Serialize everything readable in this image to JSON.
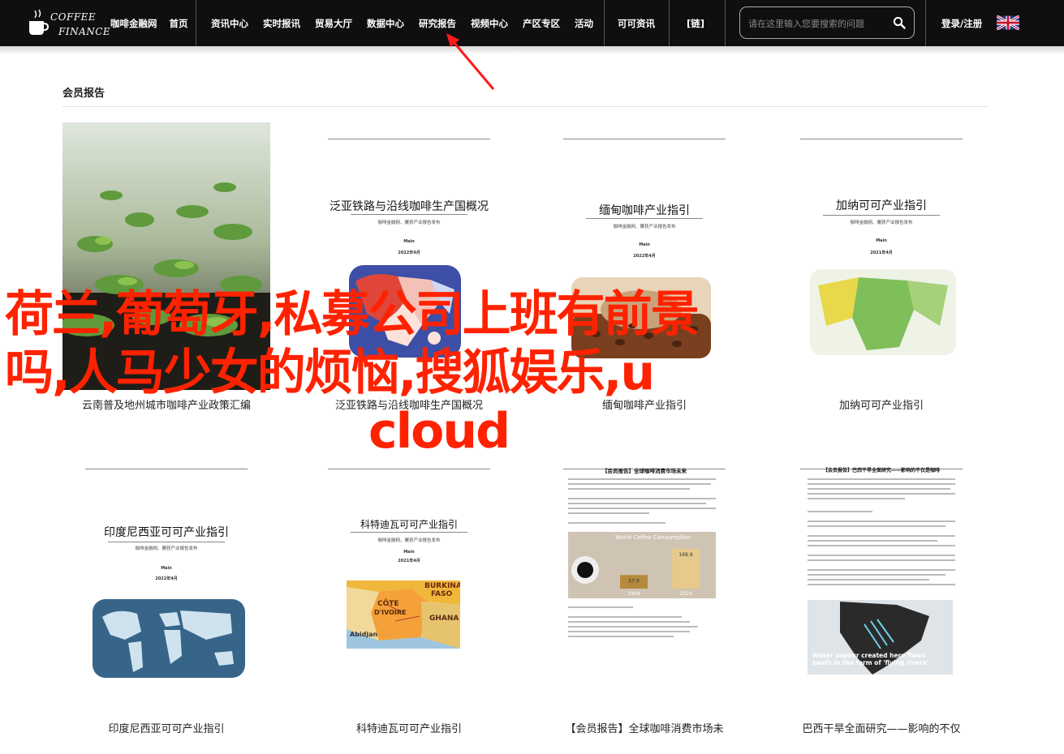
{
  "header": {
    "logo": {
      "line1": "COFFEE",
      "line2": "FINANCE"
    },
    "nav_group1": [
      "咖啡金融网",
      "首页"
    ],
    "nav_group2": [
      "资讯中心",
      "实时报讯",
      "贸易大厅",
      "数据中心",
      "研究报告",
      "视频中心",
      "产区专区",
      "活动"
    ],
    "nav_group3": [
      "可可资讯"
    ],
    "nav_group4": [
      "[链]"
    ],
    "search_placeholder": "请在这里输入您要搜索的问题",
    "login": "登录/注册",
    "icons": {
      "search": "search-icon",
      "flag": "uk-flag-icon",
      "logo": "coffee-cup-icon"
    }
  },
  "section_title": "会员报告",
  "row1": [
    {
      "kind": "photo",
      "caption": "云南普及地州城市咖啡产业政策汇编"
    },
    {
      "kind": "doc",
      "title": "泛亚铁路与沿线咖啡生产国概况",
      "sub": "咖啡金融网、屡获产业报告发布",
      "org": "Main",
      "date": "2022年4月",
      "caption": "泛亚铁路与沿线咖啡生产国概况"
    },
    {
      "kind": "doc",
      "title": "缅甸咖啡产业指引",
      "sub": "咖啡金融网、屡获产业报告发布",
      "org": "Main",
      "date": "2022年4月",
      "caption": "缅甸咖啡产业指引"
    },
    {
      "kind": "doc",
      "title": "加纳可可产业指引",
      "sub": "咖啡金融网、屡获产业报告发布",
      "org": "Main",
      "date": "2021年4月",
      "caption": "加纳可可产业指引"
    }
  ],
  "row2": [
    {
      "kind": "doc",
      "title": "印度尼西亚可可产业指引",
      "sub": "咖啡金融网、屡获产业报告发布",
      "org": "Main",
      "date": "2022年4月",
      "caption": "印度尼西亚可可产业指引"
    },
    {
      "kind": "doc",
      "title": "科特迪瓦可可产业指引",
      "sub": "咖啡金融网、屡获产业报告发布",
      "org": "Main",
      "date": "2021年4月",
      "caption": "科特迪瓦可可产业指引",
      "map_labels": [
        "BURKINA",
        "FASO",
        "CÔTE",
        "D'IVOIRE",
        "GHANA",
        "Abidjan"
      ]
    },
    {
      "kind": "article",
      "title": "【会员报告】全球咖啡消费市场未来",
      "caption": "【会员报告】全球咖啡消费市场未",
      "chart": {
        "title": "World Coffee Consumption",
        "categories": [
          "1964",
          "2019"
        ],
        "values": [
          57.9,
          169.9
        ],
        "value_labels": [
          "57.9",
          "169.9"
        ]
      }
    },
    {
      "kind": "article",
      "title": "【会员报告】巴西干旱全面研究——影响的不仅是咖啡",
      "caption": "巴西干旱全面研究——影响的不仅",
      "map_caption": "Water vapour created here flows south in the form of 'flying rivers'."
    }
  ],
  "overlay_title": [
    "荷兰,葡萄牙,私募公司上班有前景",
    "吗,人马少女的烦恼,搜狐娱乐,u",
    "cloud"
  ]
}
